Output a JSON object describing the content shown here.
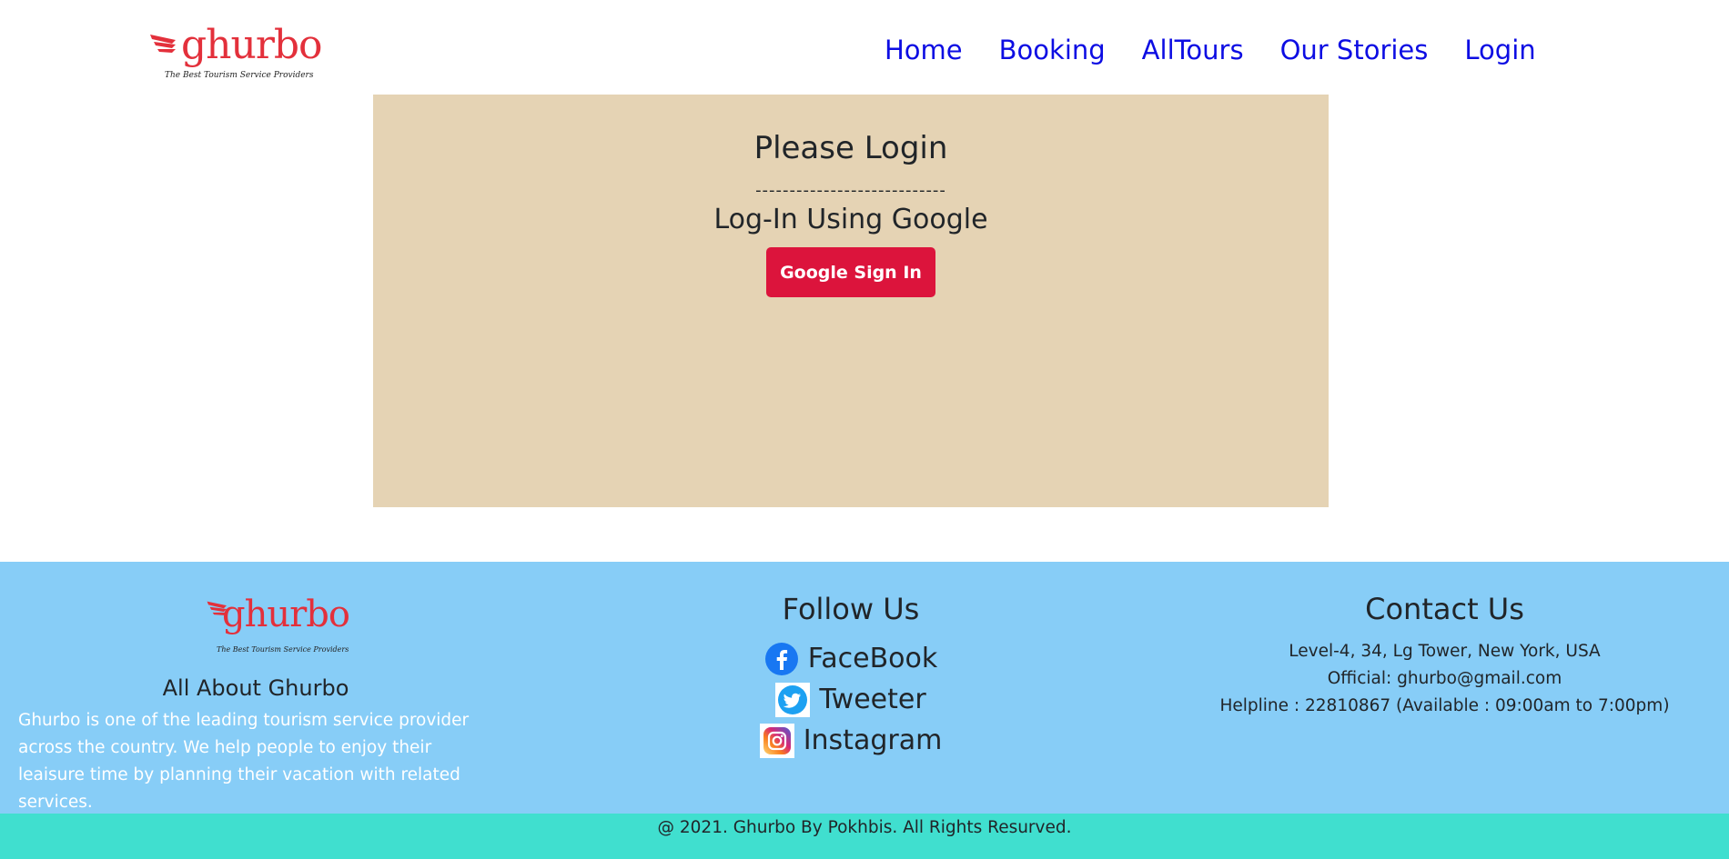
{
  "brand": {
    "name": "Ghurbo",
    "tagline": "The Best Tourism Service Providers",
    "color": "#e3303b"
  },
  "nav": {
    "items": [
      "Home",
      "Booking",
      "AllTours",
      "Our Stories",
      "Login"
    ],
    "color": "#0d0de3"
  },
  "login": {
    "title": "Please Login",
    "divider": "----------------------------",
    "subtitle": "Log-In Using Google",
    "button": "Google Sign In",
    "panel_color": "#e5d3b4",
    "button_color": "#dc143c"
  },
  "footer": {
    "about": {
      "heading": "All About Ghurbo",
      "text": "Ghurbo is one of the leading tourism service provider across the country. We help people to enjoy their leaisure time by planning their vacation with related services."
    },
    "follow": {
      "heading": "Follow Us",
      "links": [
        {
          "label": "FaceBook",
          "icon": "facebook-icon"
        },
        {
          "label": "Tweeter",
          "icon": "twitter-icon"
        },
        {
          "label": "Instagram",
          "icon": "instagram-icon"
        }
      ]
    },
    "contact": {
      "heading": "Contact Us",
      "address": "Level-4, 34, Lg Tower, New York, USA",
      "email": "Official: ghurbo@gmail.com",
      "helpline": "Helpline : 22810867 (Available : 09:00am to 7:00pm)"
    },
    "background": "#87cdf7",
    "copyright": "@ 2021. Ghurbo By Pokhbis. All Rights Resurved.",
    "copyright_bg": "#40dfcf"
  }
}
